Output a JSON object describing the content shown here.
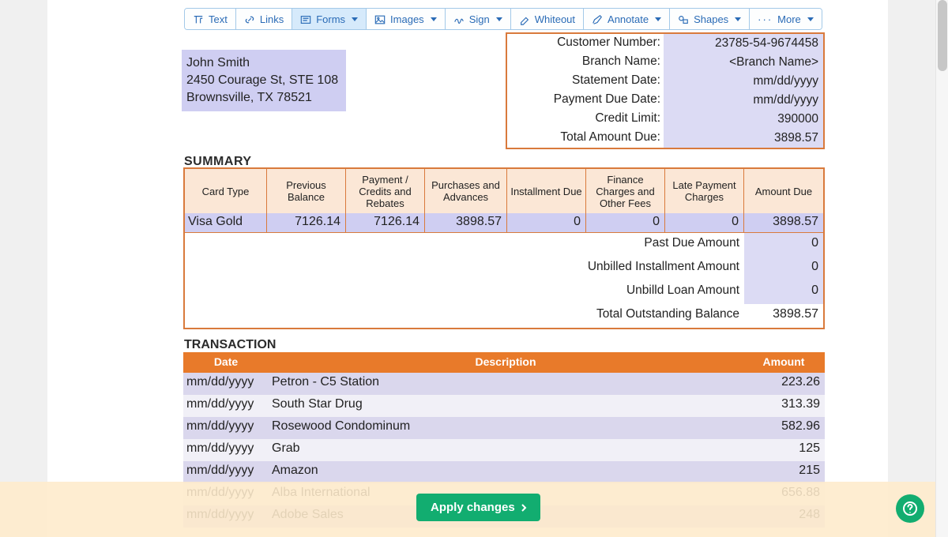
{
  "toolbar": {
    "text": "Text",
    "links": "Links",
    "forms": "Forms",
    "images": "Images",
    "sign": "Sign",
    "whiteout": "Whiteout",
    "annotate": "Annotate",
    "shapes": "Shapes",
    "more": "More"
  },
  "customer": {
    "name": "John Smith",
    "addr1": "2450 Courage St, STE 108",
    "addr2": "Brownsville, TX 78521"
  },
  "meta": {
    "labels": {
      "customer_number": "Customer Number:",
      "branch_name": "Branch Name:",
      "statement_date": "Statement Date:",
      "payment_due_date": "Payment Due Date:",
      "credit_limit": "Credit Limit:",
      "total_amount_due": "Total Amount Due:"
    },
    "values": {
      "customer_number": "23785-54-9674458",
      "branch_name": "<Branch Name>",
      "statement_date": "mm/dd/yyyy",
      "payment_due_date": "mm/dd/yyyy",
      "credit_limit": "390000",
      "total_amount_due": "3898.57"
    }
  },
  "summary": {
    "title": "SUMMARY",
    "headers": {
      "card_type": "Card Type",
      "previous_balance": "Previous Balance",
      "payment_credits": "Payment / Credits and Rebates",
      "purchases": "Purchases and Advances",
      "installment_due": "Installment Due",
      "finance_charges": "Finance Charges and Other Fees",
      "late_payment": "Late Payment Charges",
      "amount_due": "Amount Due"
    },
    "row": {
      "card_type": "Visa Gold",
      "previous_balance": "7126.14",
      "payment_credits": "7126.14",
      "purchases": "3898.57",
      "installment_due": "0",
      "finance_charges": "0",
      "late_payment": "0",
      "amount_due": "3898.57"
    },
    "subtotals": {
      "labels": {
        "past_due": "Past Due Amount",
        "unbilled": "Unbilled Installment Amount",
        "unbilled_ln": "Unbilld Loan Amount",
        "total_out": "Total Outstanding Balance"
      },
      "values": {
        "past_due": "0",
        "unbilled": "0",
        "unbilled_ln": "0",
        "total_out": "3898.57"
      }
    }
  },
  "transactions": {
    "title": "TRANSACTION",
    "headers": {
      "date": "Date",
      "description": "Description",
      "amount": "Amount"
    },
    "rows": [
      {
        "date": "mm/dd/yyyy",
        "desc": "Petron - C5 Station",
        "amt": "223.26"
      },
      {
        "date": "mm/dd/yyyy",
        "desc": "South Star Drug",
        "amt": "313.39"
      },
      {
        "date": "mm/dd/yyyy",
        "desc": "Rosewood Condominum",
        "amt": "582.96"
      },
      {
        "date": "mm/dd/yyyy",
        "desc": "Grab",
        "amt": "125"
      },
      {
        "date": "mm/dd/yyyy",
        "desc": "Amazon",
        "amt": "215"
      },
      {
        "date": "mm/dd/yyyy",
        "desc": "Alba International",
        "amt": "656.88"
      },
      {
        "date": "mm/dd/yyyy",
        "desc": "Adobe Sales",
        "amt": "248"
      }
    ]
  },
  "apply_button": "Apply changes"
}
